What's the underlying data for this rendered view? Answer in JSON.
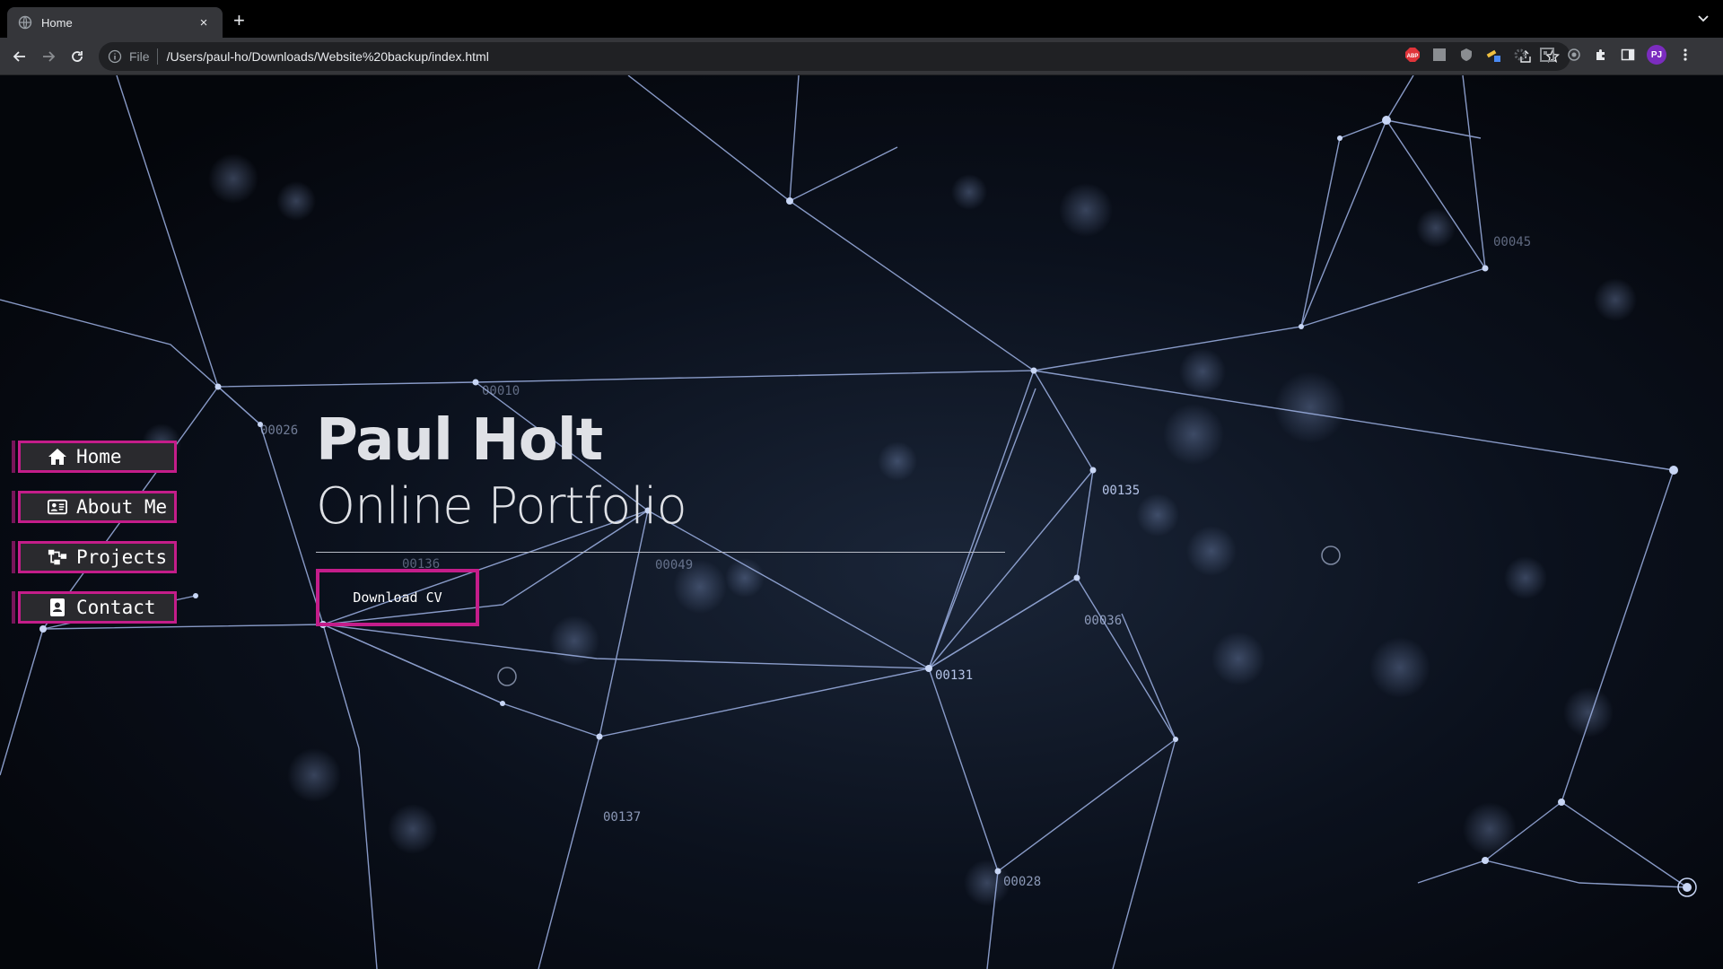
{
  "browser": {
    "tab_title": "Home",
    "tab_close": "×",
    "new_tab": "+",
    "url_scheme": "File",
    "url": "/Users/paul-ho/Downloads/Website%20backup/index.html",
    "profile_initials": "PJ"
  },
  "nav": {
    "items": [
      {
        "label": "Home",
        "icon": "home-icon"
      },
      {
        "label": "About Me",
        "icon": "id-card-icon"
      },
      {
        "label": "Projects",
        "icon": "sitemap-icon"
      },
      {
        "label": "Contact",
        "icon": "address-book-icon"
      }
    ]
  },
  "hero": {
    "title": "Paul Holt",
    "subtitle": "Online Portfolio",
    "cta_label": "Download CV"
  },
  "background_labels": [
    "00135",
    "00131",
    "00036",
    "00049",
    "00137",
    "00028",
    "00026",
    "00010",
    "00136",
    "00045"
  ],
  "colors": {
    "accent": "#c41d8a",
    "nav_bg": "#2a2a2e",
    "text": "#dfe1e6",
    "network_line": "#9fb3e6"
  }
}
